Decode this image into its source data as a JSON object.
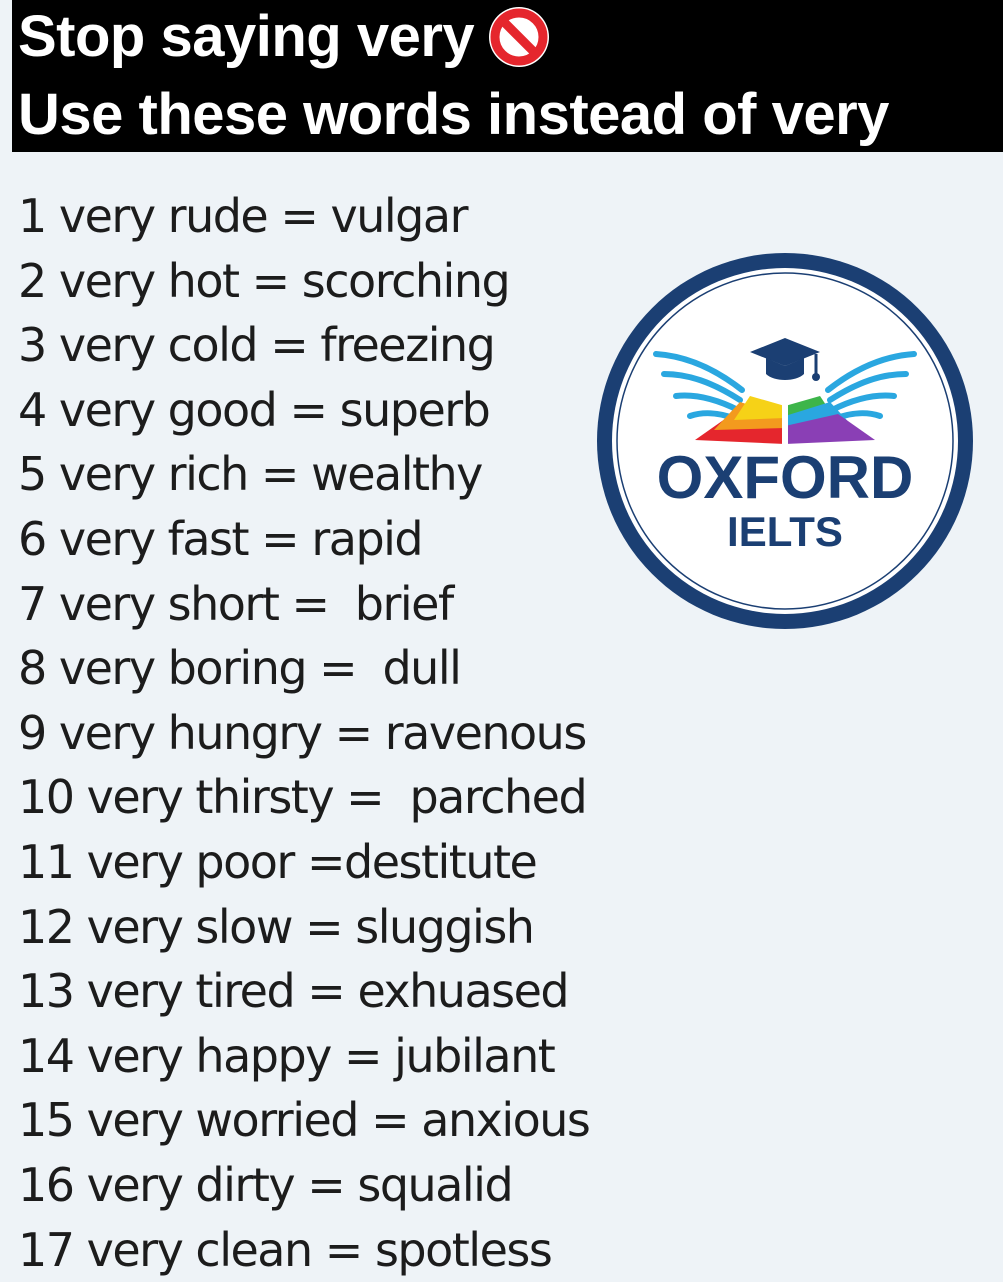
{
  "header": {
    "line1": "Stop saying very",
    "line2": "Use these words instead of very",
    "icon": "prohibited-icon"
  },
  "words": [
    "1 very rude = vulgar",
    "2 very hot = scorching",
    "3 very cold = freezing",
    "4 very good = superb",
    "5 very rich = wealthy",
    "6 very fast = rapid",
    "7 very short =  brief",
    "8 very boring =  dull",
    "9 very hungry = ravenous",
    "10 very thirsty =  parched",
    "11 very poor =destitute",
    "12 very slow = sluggish",
    "13 very tired = exhuased",
    "14 very happy = jubilant",
    "15 very worried = anxious",
    "16 very dirty = squalid",
    "17 very clean = spotless"
  ],
  "logo": {
    "brand": "OXFORD",
    "subtitle": "IELTS"
  },
  "colors": {
    "background": "#eef3f7",
    "header_bg": "#000000",
    "header_text": "#ffffff",
    "text": "#1c1c1c",
    "logo_navy": "#1b3f73",
    "logo_blue": "#2aa7e0",
    "stop_red": "#e5262d"
  }
}
